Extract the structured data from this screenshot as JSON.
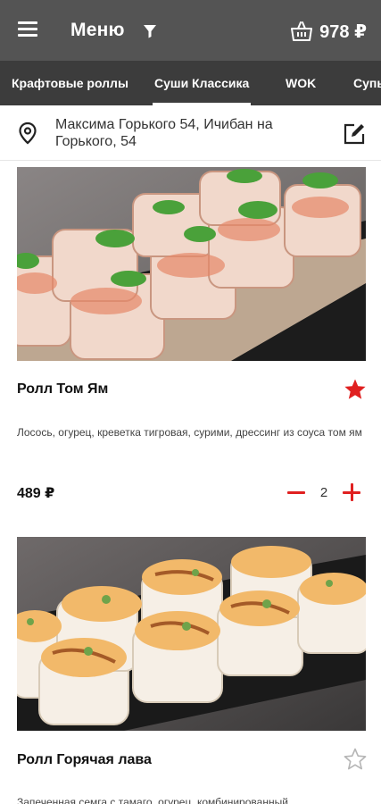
{
  "header": {
    "menu_icon": "hamburger-menu-icon",
    "title": "Меню",
    "filter_icon": "filter-icon",
    "cart_icon": "basket-icon",
    "cart_total": "978 ₽"
  },
  "tabs": [
    {
      "label": "Крафтовые роллы",
      "active": false
    },
    {
      "label": "Суши Классика",
      "active": true
    },
    {
      "label": "WOK",
      "active": false
    },
    {
      "label": "Супы",
      "active": false
    }
  ],
  "address": {
    "pin_icon": "location-pin-icon",
    "text": "Максима Горького 54, Ичибан на Горького, 54",
    "edit_icon": "edit-icon"
  },
  "products": [
    {
      "name": "Ролл Том Ям",
      "description": "Лосось, огурец, креветка тигровая, сурими, дрессинг из соуса том ям",
      "price": "489 ₽",
      "quantity": "2",
      "favorite": true
    },
    {
      "name": "Ролл Горячая лава",
      "description": "Запеченная семга с тамаго, огурец, комбинированный",
      "favorite": false
    }
  ],
  "colors": {
    "header_bg": "#545454",
    "tabs_bg": "#3c3c3c",
    "accent": "#e02020"
  }
}
